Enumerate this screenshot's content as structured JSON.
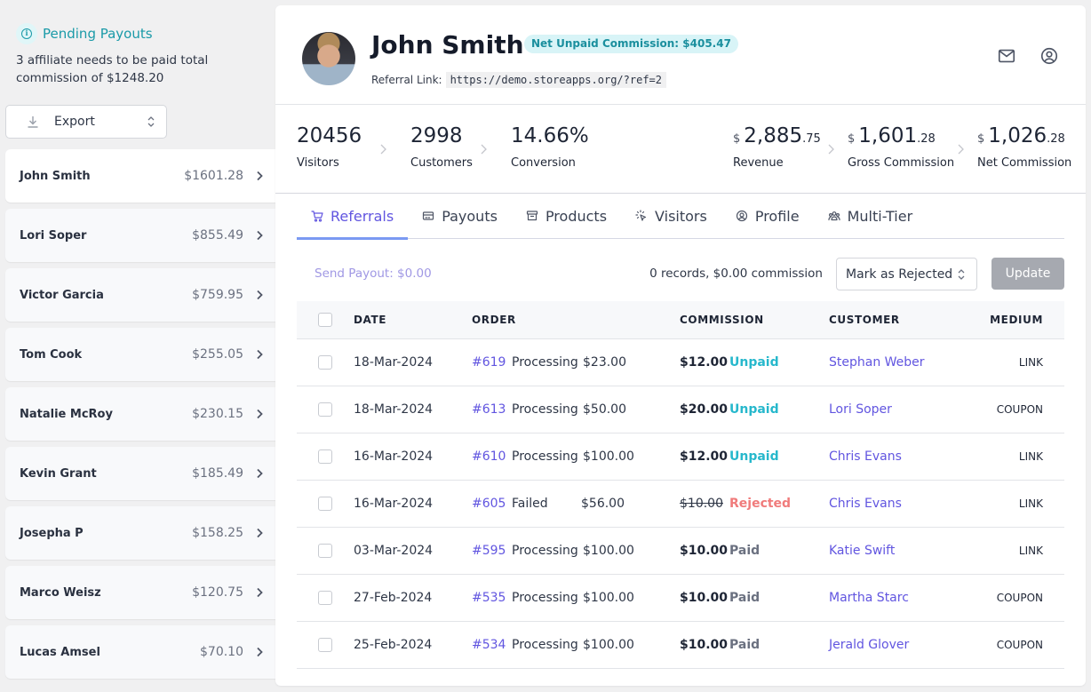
{
  "pending": {
    "title": "Pending Payouts",
    "text": "3 affiliate needs to be paid total commission of $1248.20"
  },
  "export": {
    "label": "Export"
  },
  "affiliates": [
    {
      "name": "John Smith",
      "amount": "$1601.28",
      "active": true
    },
    {
      "name": "Lori Soper",
      "amount": "$855.49"
    },
    {
      "name": "Victor Garcia",
      "amount": "$759.95"
    },
    {
      "name": "Tom Cook",
      "amount": "$255.05"
    },
    {
      "name": "Natalie McRoy",
      "amount": "$230.15"
    },
    {
      "name": "Kevin Grant",
      "amount": "$185.49"
    },
    {
      "name": "Josepha P",
      "amount": "$158.25"
    },
    {
      "name": "Marco Weisz",
      "amount": "$120.75"
    },
    {
      "name": "Lucas Amsel",
      "amount": "$70.10"
    }
  ],
  "profile": {
    "name": "John Smith",
    "net_unpaid_badge": "Net Unpaid Commission: $405.47",
    "referral_label": "Referral Link:",
    "referral_link": "https://demo.storeapps.org/?ref=2"
  },
  "stats": {
    "visitors": {
      "value": "20456",
      "label": "Visitors"
    },
    "customers": {
      "value": "2998",
      "label": "Customers"
    },
    "conversion": {
      "value": "14.66%",
      "label": "Conversion"
    },
    "revenue": {
      "currency": "$",
      "whole": "2,885",
      "cents": ".75",
      "label": "Revenue"
    },
    "gross_commission": {
      "currency": "$",
      "whole": "1,601",
      "cents": ".28",
      "label": "Gross Commission"
    },
    "net_commission": {
      "currency": "$",
      "whole": "1,026",
      "cents": ".28",
      "label": "Net Commission"
    }
  },
  "tabs": [
    {
      "label": "Referrals",
      "icon": "cart-icon",
      "active": true
    },
    {
      "label": "Payouts",
      "icon": "credit-card-icon"
    },
    {
      "label": "Products",
      "icon": "archive-box-icon"
    },
    {
      "label": "Visitors",
      "icon": "cursor-click-icon"
    },
    {
      "label": "Profile",
      "icon": "user-circle-icon"
    },
    {
      "label": "Multi-Tier",
      "icon": "user-group-icon"
    }
  ],
  "toolbar": {
    "send_payout": "Send Payout: $0.00",
    "records_summary": "0 records, $0.00 commission",
    "status_select": "Mark as Rejected",
    "update_label": "Update"
  },
  "table": {
    "headers": {
      "date": "DATE",
      "order": "ORDER",
      "commission": "COMMISSION",
      "customer": "CUSTOMER",
      "medium": "MEDIUM"
    },
    "rows": [
      {
        "date": "18-Mar-2024",
        "order": "#619",
        "order_status": "Processing",
        "total": "$23.00",
        "commission": "$12.00",
        "payout_status": "Unpaid",
        "customer": "Stephan Weber",
        "medium": "LINK"
      },
      {
        "date": "18-Mar-2024",
        "order": "#613",
        "order_status": "Processing",
        "total": "$50.00",
        "commission": "$20.00",
        "payout_status": "Unpaid",
        "customer": "Lori Soper",
        "medium": "COUPON"
      },
      {
        "date": "16-Mar-2024",
        "order": "#610",
        "order_status": "Processing",
        "total": "$100.00",
        "commission": "$12.00",
        "payout_status": "Unpaid",
        "customer": "Chris Evans",
        "medium": "LINK"
      },
      {
        "date": "16-Mar-2024",
        "order": "#605",
        "order_status": "Failed",
        "total": "$56.00",
        "commission": "$10.00",
        "payout_status": "Rejected",
        "customer": "Chris Evans",
        "medium": "LINK"
      },
      {
        "date": "03-Mar-2024",
        "order": "#595",
        "order_status": "Processing",
        "total": "$100.00",
        "commission": "$10.00",
        "payout_status": "Paid",
        "customer": "Katie Swift",
        "medium": "LINK"
      },
      {
        "date": "27-Feb-2024",
        "order": "#535",
        "order_status": "Processing",
        "total": "$100.00",
        "commission": "$10.00",
        "payout_status": "Paid",
        "customer": "Martha Starc",
        "medium": "COUPON"
      },
      {
        "date": "25-Feb-2024",
        "order": "#534",
        "order_status": "Processing",
        "total": "$100.00",
        "commission": "$10.00",
        "payout_status": "Paid",
        "customer": "Jerald Glover",
        "medium": "COUPON"
      }
    ]
  },
  "colors": {
    "accent": "#6155e0",
    "teal": "#1a9aa8",
    "unpaid": "#27b8cc",
    "rejected": "#f07b7b",
    "paid": "#6b7180",
    "tab_underline": "#7b9af2"
  }
}
